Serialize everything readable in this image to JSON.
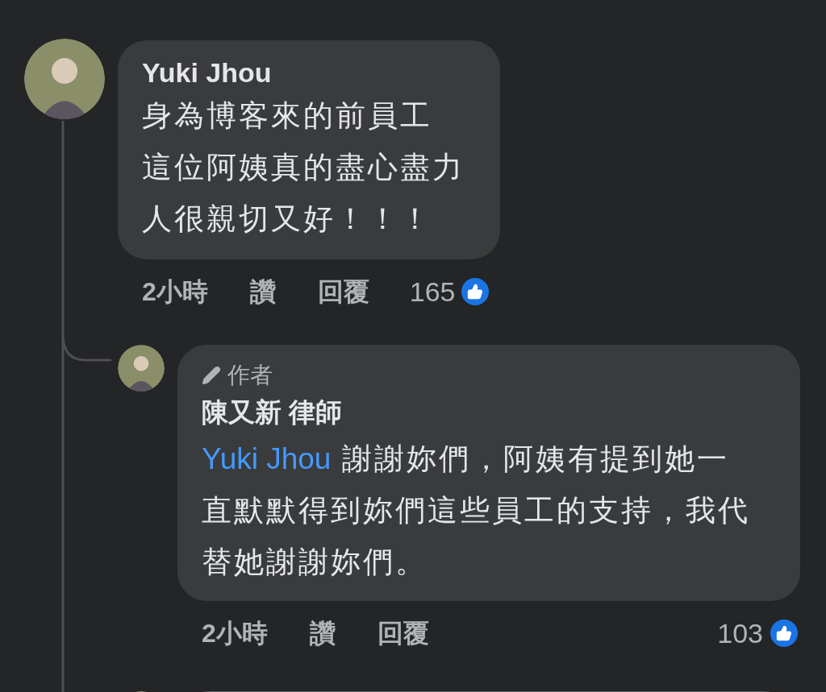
{
  "comment": {
    "author": "Yuki Jhou",
    "text_lines": [
      "身為博客來的前員工",
      "這位阿姨真的盡心盡力",
      "人很親切又好！！！"
    ],
    "time": "2小時",
    "like": "讚",
    "reply": "回覆",
    "reaction_count": "165"
  },
  "reply": {
    "badge": "作者",
    "author": "陳又新 律師",
    "mention": "Yuki Jhou",
    "text_lines": [
      "謝謝妳們，阿姨有提到她一",
      "直默默得到妳們這些員工的支持，我代",
      "替她謝謝妳們。"
    ],
    "time": "2小時",
    "like": "讚",
    "reply": "回覆",
    "reaction_count": "103"
  }
}
